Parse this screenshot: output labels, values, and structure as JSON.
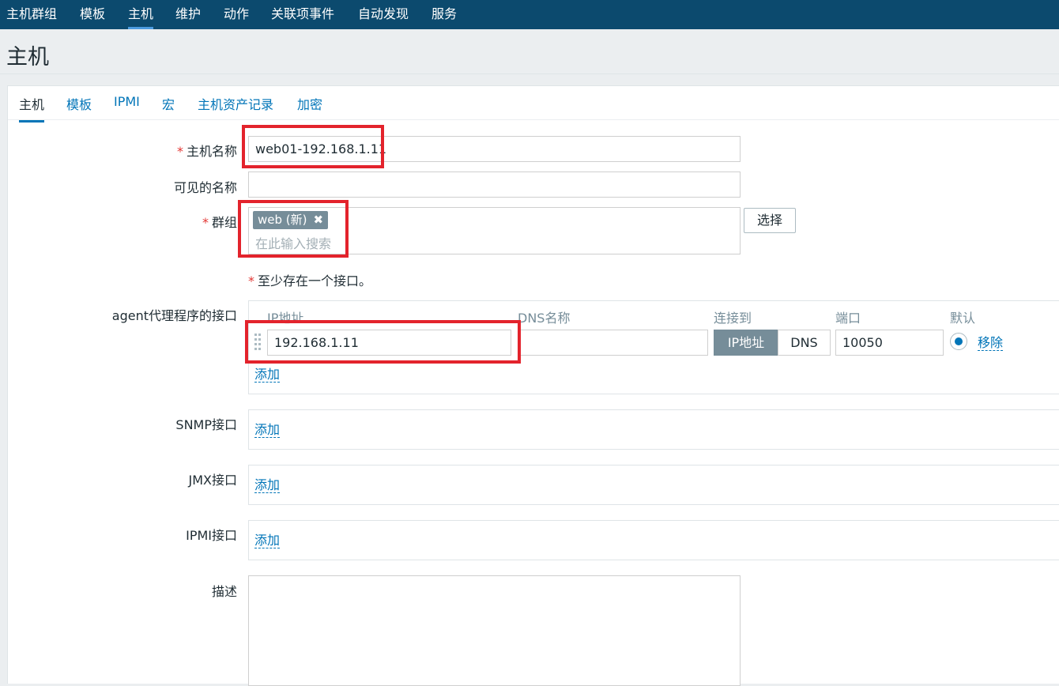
{
  "topnav": {
    "items": [
      "主机群组",
      "模板",
      "主机",
      "维护",
      "动作",
      "关联项事件",
      "自动发现",
      "服务"
    ],
    "active": "主机"
  },
  "page": {
    "title": "主机"
  },
  "tabs": [
    "主机",
    "模板",
    "IPMI",
    "宏",
    "主机资产记录",
    "加密"
  ],
  "form": {
    "host_name": {
      "label": "主机名称",
      "value": "web01-192.168.1.11",
      "required": true
    },
    "visible_name": {
      "label": "可见的名称",
      "value": ""
    },
    "groups": {
      "label": "群组",
      "required": true,
      "chips": [
        "web (新)"
      ],
      "chip_close": "✖",
      "placeholder": "在此输入搜索",
      "select_button": "选择"
    },
    "interface_note": "至少存在一个接口。",
    "agent": {
      "label": "agent代理程序的接口",
      "headers": {
        "ip": "IP地址",
        "dns": "DNS名称",
        "connect": "连接到",
        "port": "端口",
        "default": "默认"
      },
      "row": {
        "ip": "192.168.1.11",
        "dns": "",
        "connect_options": [
          "IP地址",
          "DNS"
        ],
        "connect_selected": "IP地址",
        "port": "10050",
        "remove": "移除"
      },
      "add": "添加"
    },
    "snmp": {
      "label": "SNMP接口",
      "add": "添加"
    },
    "jmx": {
      "label": "JMX接口",
      "add": "添加"
    },
    "ipmi": {
      "label": "IPMI接口",
      "add": "添加"
    },
    "description": {
      "label": "描述",
      "value": ""
    }
  },
  "colors": {
    "nav_bg": "#0c4a6e",
    "link": "#0275b8",
    "highlight": "#e3232c",
    "segment_active": "#768d99"
  },
  "icons": {
    "drag": "drag-handle-icon",
    "chip_remove": "close-icon"
  }
}
